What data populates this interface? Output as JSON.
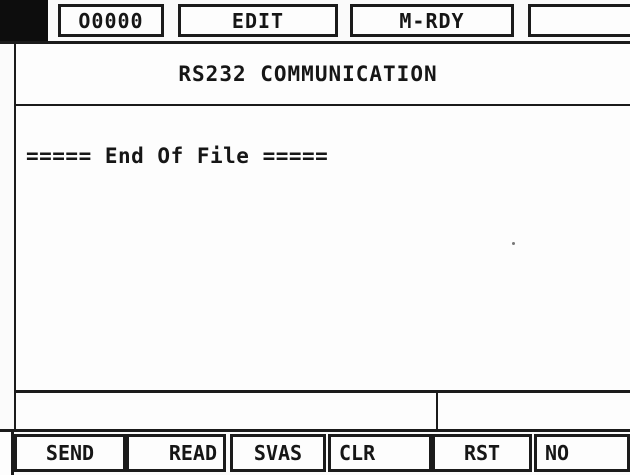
{
  "status_bar": {
    "program_number": "O0000",
    "mode": "EDIT",
    "machine_state": "M-RDY",
    "extra": ""
  },
  "screen": {
    "title": "RS232 COMMUNICATION",
    "end_of_file": "===== End Of File ====="
  },
  "input_line": {
    "value": "",
    "message": ""
  },
  "softkeys": [
    {
      "label": "SEND"
    },
    {
      "label": "READ"
    },
    {
      "label": "SVAS"
    },
    {
      "label": "CLR"
    },
    {
      "label": "RST"
    },
    {
      "label": "NO"
    }
  ]
}
